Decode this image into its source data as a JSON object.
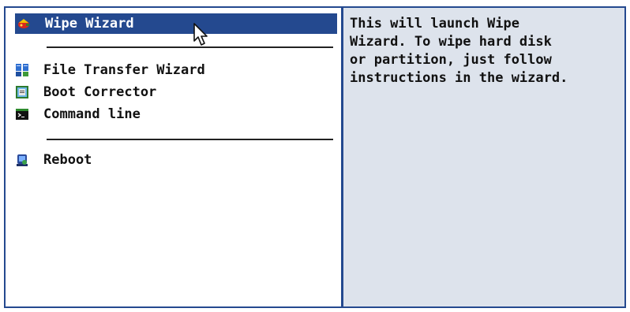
{
  "menu": {
    "items": [
      {
        "label": "Wipe Wizard",
        "icon": "wipe-wizard-icon",
        "selected": true
      },
      {
        "label": "File Transfer Wizard",
        "icon": "file-transfer-icon",
        "selected": false
      },
      {
        "label": "Boot Corrector",
        "icon": "boot-corrector-icon",
        "selected": false
      },
      {
        "label": "Command line",
        "icon": "terminal-icon",
        "selected": false
      },
      {
        "label": "Reboot",
        "icon": "reboot-icon",
        "selected": false
      }
    ]
  },
  "description": {
    "text": "This will launch Wipe\nWizard. To wipe hard disk\nor partition, just follow\ninstructions in the wizard."
  },
  "colors": {
    "selection": "#24498f",
    "border": "#24498f",
    "description_bg": "#dde3ec"
  }
}
